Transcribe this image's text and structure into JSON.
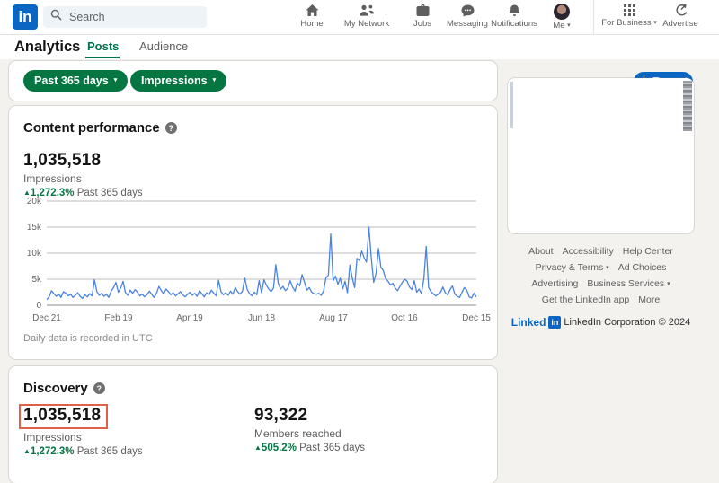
{
  "ui": {
    "caret_down": "▾",
    "up_triangle": "▲",
    "question_mark": "?"
  },
  "topnav": {
    "logo_text": "in",
    "search": {
      "placeholder": "Search"
    },
    "items": [
      {
        "label": "Home"
      },
      {
        "label": "My Network"
      },
      {
        "label": "Jobs"
      },
      {
        "label": "Messaging"
      },
      {
        "label": "Notifications"
      },
      {
        "label": "Me"
      },
      {
        "label": "For Business"
      },
      {
        "label": "Advertise"
      }
    ]
  },
  "subheader": {
    "title": "Analytics",
    "tabs": [
      {
        "label": "Posts",
        "active": true
      },
      {
        "label": "Audience",
        "active": false
      }
    ],
    "export_label": "Export"
  },
  "filters": {
    "pills": [
      {
        "label": "Past 365 days"
      },
      {
        "label": "Impressions"
      }
    ]
  },
  "content_performance": {
    "title": "Content performance",
    "stat": {
      "value": "1,035,518",
      "label": "Impressions",
      "change": "1,272.3%",
      "period": "Past 365 days"
    },
    "footnote": "Daily data is recorded in UTC"
  },
  "chart_data": {
    "type": "line",
    "title": "Content performance — daily impressions, past 365 days",
    "series_name": "Impressions",
    "x_tick_labels": [
      "Dec 21",
      "Feb 19",
      "Apr 19",
      "Jun 18",
      "Aug 17",
      "Oct 16",
      "Dec 15"
    ],
    "y_tick_labels": [
      "0",
      "5k",
      "10k",
      "15k",
      "20k"
    ],
    "ylim": [
      0,
      20000
    ],
    "grid": true,
    "line_color": "#4a82e0",
    "sampling": "approximately every 2 days from Dec 21 to Dec 15",
    "values": [
      1100,
      1600,
      2800,
      2200,
      1700,
      2100,
      1500,
      2600,
      2300,
      1800,
      2100,
      1500,
      1900,
      2400,
      1700,
      1300,
      2000,
      1600,
      2200,
      1800,
      4900,
      2600,
      1900,
      2300,
      1700,
      2100,
      1500,
      2700,
      3400,
      4400,
      2500,
      3300,
      4600,
      2400,
      1900,
      2900,
      2300,
      3000,
      2500,
      1800,
      2100,
      1600,
      2000,
      2700,
      2100,
      1500,
      2300,
      3600,
      2800,
      2200,
      3100,
      2600,
      2000,
      2400,
      1800,
      2200,
      2600,
      2000,
      1600,
      2100,
      2500,
      1900,
      2300,
      1700,
      2800,
      2200,
      1600,
      2400,
      2000,
      2900,
      2300,
      1800,
      4800,
      2600,
      2000,
      2400,
      1900,
      2700,
      2100,
      3400,
      2600,
      2100,
      2700,
      5200,
      3000,
      2200,
      1800,
      2500,
      2000,
      4700,
      2400,
      4900,
      3900,
      3100,
      2600,
      3300,
      7800,
      4200,
      3100,
      3600,
      2800,
      3300,
      4700,
      3500,
      2700,
      4300,
      3700,
      5900,
      4400,
      2900,
      3400,
      2500,
      2200,
      2100,
      2300,
      1900,
      2700,
      5300,
      5800,
      13700,
      4700,
      5600,
      4000,
      5200,
      3100,
      4600,
      2400,
      7700,
      5300,
      3400,
      9000,
      8600,
      10400,
      9100,
      8300,
      15000,
      8900,
      4400,
      6200,
      10900,
      7300,
      6700,
      5100,
      4600,
      3900,
      4200,
      3300,
      2800,
      3600,
      4400,
      5000,
      4600,
      3500,
      3000,
      4700,
      2500,
      3100,
      2200,
      5100,
      11300,
      3400,
      2600,
      2200,
      1800,
      2100,
      2500,
      3500,
      2400,
      2000,
      3000,
      3700,
      2100,
      1700,
      1500,
      2500,
      3400,
      2900,
      1600,
      1400,
      2300,
      1600
    ]
  },
  "discovery": {
    "title": "Discovery",
    "highlight_box_color": "#e0604a",
    "stats": [
      {
        "value": "1,035,518",
        "label": "Impressions",
        "change": "1,272.3%",
        "period": "Past 365 days",
        "highlighted": true
      },
      {
        "value": "93,322",
        "label": "Members reached",
        "change": "505.2%",
        "period": "Past 365 days",
        "highlighted": false
      }
    ]
  },
  "right_rail": {
    "links": [
      "About",
      "Accessibility",
      "Help Center",
      "Privacy & Terms",
      "Ad Choices",
      "Advertising",
      "Business Services",
      "Get the LinkedIn app",
      "More"
    ],
    "brand_text": "Linked",
    "logo_badge": "in",
    "copyright": "LinkedIn Corporation © 2024"
  },
  "colors": {
    "accent_green": "#057642",
    "accent_blue": "#0a66c2",
    "chart_line": "#4a82e0",
    "highlight_red": "#e0604a"
  }
}
